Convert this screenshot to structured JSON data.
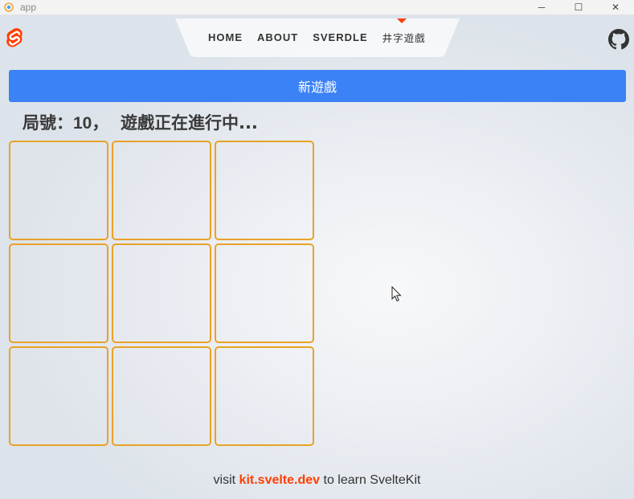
{
  "window": {
    "title": "app",
    "icon": "svelte-app-icon",
    "controls": {
      "minimize": "─",
      "maximize": "☐",
      "close": "✕"
    }
  },
  "header": {
    "logo": "svelte-logo",
    "nav": [
      {
        "label": "HOME"
      },
      {
        "label": "ABOUT"
      },
      {
        "label": "SVERDLE"
      },
      {
        "label": "井字遊戲",
        "active": true
      }
    ],
    "github": "github-icon",
    "accent_color": "#ff3e00"
  },
  "game": {
    "new_game_label": "新遊戲",
    "round_label": "局號：",
    "round_number": "10",
    "status_text": "，  遊戲正在進行中...",
    "board": [
      "",
      "",
      "",
      "",
      "",
      "",
      "",
      "",
      ""
    ],
    "cell_border_color": "#e9a227",
    "button_color": "#3b82f6"
  },
  "footer": {
    "prefix": "visit ",
    "link": "kit.svelte.dev",
    "suffix": " to learn SvelteKit"
  }
}
